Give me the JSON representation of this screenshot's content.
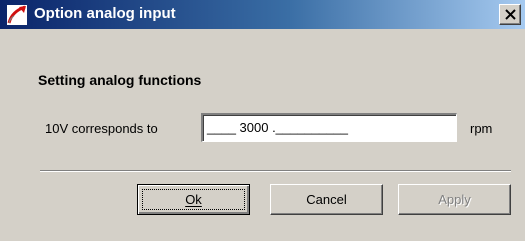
{
  "window": {
    "title": "Option analog input",
    "icon": "app-icon",
    "close_icon": "close-icon"
  },
  "content": {
    "heading": "Setting analog functions",
    "field_label": "10V corresponds to",
    "field_value": "____ 3000 .__________",
    "unit": "rpm"
  },
  "buttons": {
    "ok_label": "Ok",
    "cancel_label": "Cancel",
    "apply_label": "Apply"
  },
  "colors": {
    "title_gradient_start": "#0a246a",
    "title_gradient_end": "#a6caf0",
    "face": "#d4d0c8",
    "disabled_text": "#808080"
  }
}
